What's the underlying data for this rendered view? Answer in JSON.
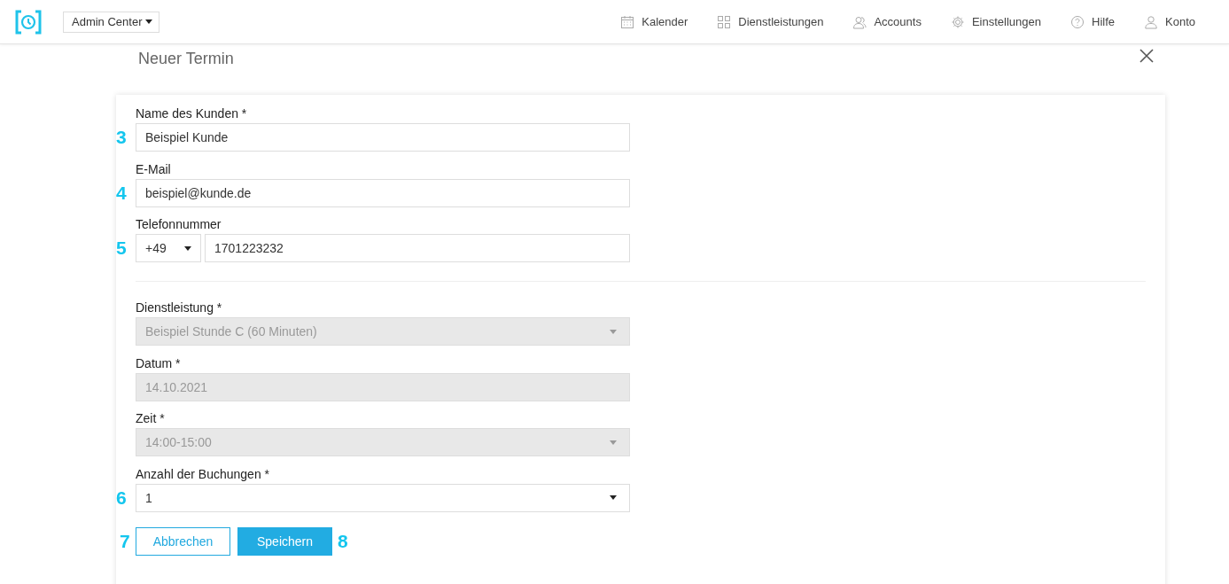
{
  "header": {
    "app_switcher": "Admin Center",
    "nav": [
      {
        "label": "Kalender"
      },
      {
        "label": "Dienstleistungen"
      },
      {
        "label": "Accounts"
      },
      {
        "label": "Einstellungen"
      },
      {
        "label": "Hilfe"
      },
      {
        "label": "Konto"
      }
    ]
  },
  "dialog": {
    "title": "Neuer Termin",
    "contact_fields": [
      {
        "label": "Name des Kunden *",
        "kind": "text",
        "value": "Beispiel Kunde",
        "disabled": false,
        "marker": "3"
      },
      {
        "label": "E-Mail",
        "kind": "text",
        "value": "beispiel@kunde.de",
        "disabled": false,
        "marker": "4"
      },
      {
        "label": "Telefonnummer",
        "kind": "phone",
        "prefix": "+49",
        "value": "1701223232",
        "disabled": false,
        "marker": "5"
      }
    ],
    "booking_fields": [
      {
        "label": "Dienstleistung *",
        "kind": "select",
        "value": "Beispiel Stunde C (60 Minuten)",
        "disabled": true
      },
      {
        "label": "Datum *",
        "kind": "text",
        "value": "14.10.2021",
        "disabled": true
      },
      {
        "label": "Zeit *",
        "kind": "select",
        "value": "14:00-15:00",
        "disabled": true
      },
      {
        "label": "Anzahl der Buchungen *",
        "kind": "select",
        "value": "1",
        "disabled": false,
        "marker": "6"
      }
    ],
    "buttons": [
      {
        "label": "Abbrechen",
        "kind": "secondary",
        "marker": "7"
      },
      {
        "label": "Speichern",
        "kind": "primary",
        "marker": "8"
      }
    ]
  }
}
